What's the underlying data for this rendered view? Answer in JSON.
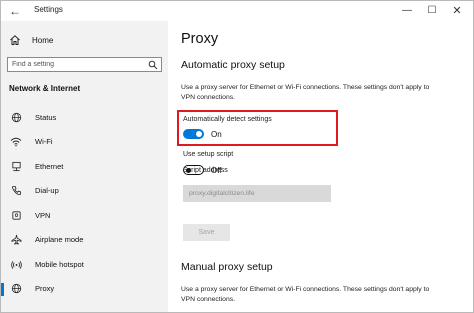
{
  "window": {
    "title": "Settings",
    "minimize": "—",
    "maximize": "☐",
    "close": "✕"
  },
  "sidebar": {
    "home_label": "Home",
    "search_placeholder": "Find a setting",
    "section_heading": "Network & Internet",
    "items": [
      {
        "label": "Status",
        "icon": "globe-icon"
      },
      {
        "label": "Wi-Fi",
        "icon": "wifi-icon"
      },
      {
        "label": "Ethernet",
        "icon": "ethernet-icon"
      },
      {
        "label": "Dial-up",
        "icon": "phone-icon"
      },
      {
        "label": "VPN",
        "icon": "vpn-icon"
      },
      {
        "label": "Airplane mode",
        "icon": "airplane-icon"
      },
      {
        "label": "Mobile hotspot",
        "icon": "hotspot-icon"
      },
      {
        "label": "Proxy",
        "icon": "globe-icon",
        "active": true
      }
    ]
  },
  "main": {
    "title": "Proxy",
    "auto": {
      "heading": "Automatic proxy setup",
      "description": "Use a proxy server for Ethernet or Wi-Fi connections. These settings don't apply to VPN connections.",
      "detect_label": "Automatically detect settings",
      "detect_state": "On",
      "script_label": "Use setup script",
      "script_state": "Off",
      "address_label": "Script address",
      "address_value": "proxy.digitalcitizen.life",
      "save_label": "Save"
    },
    "manual": {
      "heading": "Manual proxy setup",
      "description": "Use a proxy server for Ethernet or Wi-Fi connections. These settings don't apply to VPN connections."
    }
  },
  "colors": {
    "accent": "#0078d7",
    "highlight": "#e0191f",
    "sidebar_bg": "#f2f2f2"
  }
}
